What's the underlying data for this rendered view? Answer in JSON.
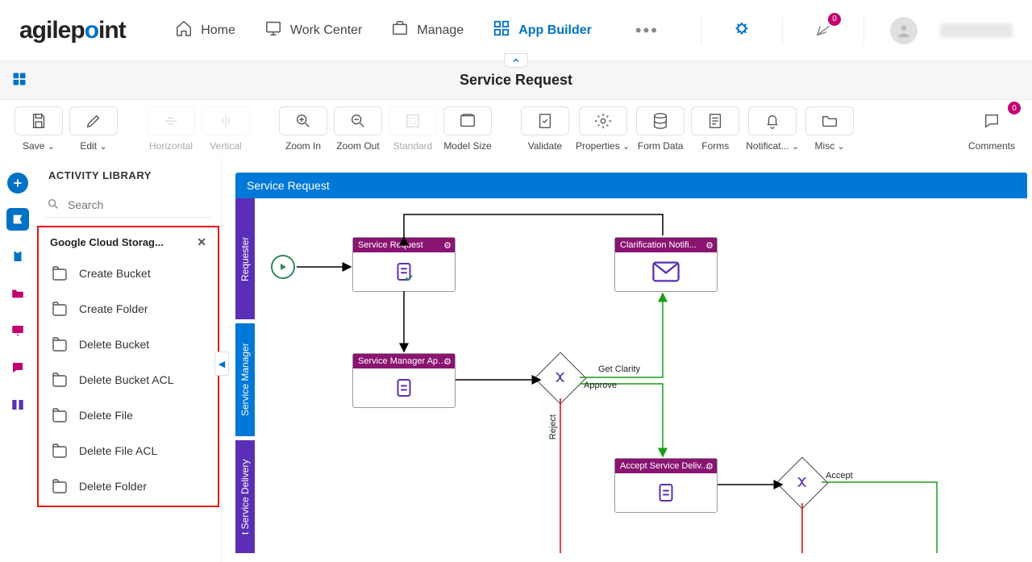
{
  "header": {
    "logo_text": "agilepoint",
    "nav": [
      {
        "label": "Home",
        "icon": "home"
      },
      {
        "label": "Work Center",
        "icon": "monitor"
      },
      {
        "label": "Manage",
        "icon": "briefcase"
      },
      {
        "label": "App Builder",
        "icon": "grid"
      }
    ],
    "notification_count": "0",
    "comment_count": "0"
  },
  "titlebar": {
    "title": "Service Request"
  },
  "toolbar": [
    {
      "label": "Save",
      "icon": "save",
      "caret": true
    },
    {
      "label": "Edit",
      "icon": "edit",
      "caret": true
    },
    {
      "label": "Horizontal",
      "icon": "align-h",
      "disabled": true
    },
    {
      "label": "Vertical",
      "icon": "align-v",
      "disabled": true
    },
    {
      "label": "Zoom In",
      "icon": "zoom-in"
    },
    {
      "label": "Zoom Out",
      "icon": "zoom-out"
    },
    {
      "label": "Standard",
      "icon": "fit",
      "disabled": true
    },
    {
      "label": "Model Size",
      "icon": "model"
    },
    {
      "label": "Validate",
      "icon": "validate"
    },
    {
      "label": "Properties",
      "icon": "properties",
      "caret": true
    },
    {
      "label": "Form Data",
      "icon": "db"
    },
    {
      "label": "Forms",
      "icon": "forms"
    },
    {
      "label": "Notificat...",
      "icon": "bell",
      "caret": true
    },
    {
      "label": "Misc",
      "icon": "folder",
      "caret": true
    }
  ],
  "toolbar_right": {
    "label": "Comments",
    "icon": "comment"
  },
  "panel": {
    "title": "ACTIVITY LIBRARY",
    "search_placeholder": "Search",
    "group": "Google Cloud Storag...",
    "items": [
      {
        "label": "Create Bucket"
      },
      {
        "label": "Create Folder"
      },
      {
        "label": "Delete Bucket"
      },
      {
        "label": "Delete Bucket ACL"
      },
      {
        "label": "Delete File"
      },
      {
        "label": "Delete File ACL"
      },
      {
        "label": "Delete Folder"
      }
    ]
  },
  "canvas": {
    "title": "Service Request",
    "lanes": [
      {
        "label": "Requester",
        "color": "purple"
      },
      {
        "label": "Service Manager",
        "color": "blue"
      },
      {
        "label": "t Service Delivery",
        "color": "purple"
      }
    ],
    "nodes": {
      "start": "Start",
      "sr": "Service Request",
      "cn": "Clarification Notifi...",
      "sma": "Service Manager Appr...",
      "asd": "Accept Service Deliv..."
    },
    "edge_labels": {
      "get_clarity": "Get Clarity",
      "approve": "Approve",
      "reject": "Reject",
      "accept": "Accept"
    }
  }
}
